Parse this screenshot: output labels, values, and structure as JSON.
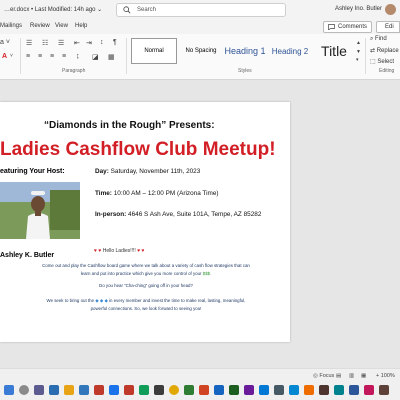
{
  "titlebar": {
    "doc_title": "…er.docx • Last Modified: 14h ago ⌄",
    "search_placeholder": "Search",
    "user_name": "Ashley Ino. Butler"
  },
  "menubar": {
    "items": [
      "Mailings",
      "Review",
      "View",
      "Help"
    ],
    "comments_label": "Comments",
    "editing_label": "Edi"
  },
  "ribbon": {
    "styles": [
      "Normal",
      "No Spacing",
      "Heading 1",
      "Heading 2",
      "Title"
    ],
    "group_labels": [
      "Paragraph",
      "Styles",
      "Editing"
    ],
    "editing": {
      "find": "Find",
      "replace": "Replace",
      "select": "Select"
    },
    "paragraph_mark": "¶"
  },
  "document": {
    "presents": "“Diamonds in the Rough” Presents:",
    "headline": "Ladies Cashflow Club Meetup!",
    "featuring": "eaturing Your Host:",
    "host_name": "Ashley K. Butler",
    "day_label": "Day:",
    "day_value": "Saturday, November 11th, 2023",
    "time_label": "Time:",
    "time_value": "10:00 AM – 12:00 PM (Arizona Time)",
    "location_label": "In-person:",
    "location_value": "4646 S Ash Ave, Suite 101A, Tempe, AZ 85282",
    "hello": "Hello Ladies!!!!",
    "body_1a": "Come out and play the Cashflow board game where we talk about a variety of cash flow strategies that can",
    "body_1b": "learn and put into practice which give you more control of your",
    "money_text": "$$$.",
    "body_2": "Do you hear “Cha-ching” going off in your head?",
    "body_3a": "We seek to bring out the",
    "body_3b": "in every member and invest the time to make real, lasting, meaningful,",
    "body_3c": "powerful connections. So, we look forward to seeing you!"
  },
  "taskbar": {
    "focus_label": "Focus",
    "zoom_label": "+ 100%"
  },
  "colors": {
    "headline_red": "#d21f26",
    "body_blue": "#1f3864",
    "heading_blue": "#2f5496"
  }
}
